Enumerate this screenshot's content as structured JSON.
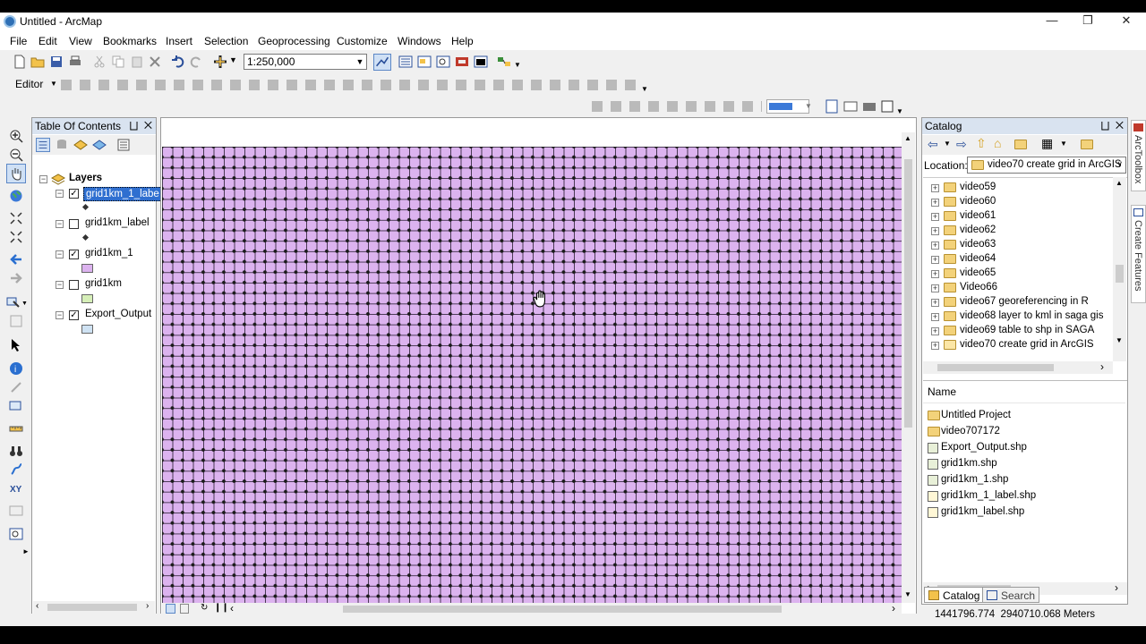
{
  "window": {
    "title": "Untitled - ArcMap",
    "minimize_icon": "minimize-icon",
    "maximize_icon": "maximize-icon",
    "close_icon": "close-icon"
  },
  "menu": [
    "File",
    "Edit",
    "View",
    "Bookmarks",
    "Insert",
    "Selection",
    "Geoprocessing",
    "Customize",
    "Windows",
    "Help"
  ],
  "toolbar": {
    "scale_value": "1:250,000",
    "editor_label": "Editor"
  },
  "toc": {
    "title": "Table Of Contents",
    "root": "Layers",
    "layers": [
      {
        "name": "grid1km_1_labe",
        "checked": true,
        "symbol": "point",
        "selected": true
      },
      {
        "name": "grid1km_label",
        "checked": false,
        "symbol": "point",
        "selected": false
      },
      {
        "name": "grid1km_1",
        "checked": true,
        "symbol": "#dcb3ef",
        "selected": false
      },
      {
        "name": "grid1km",
        "checked": false,
        "symbol": "#d6efb8",
        "selected": false
      },
      {
        "name": "Export_Output",
        "checked": true,
        "symbol": "#cfe2f3",
        "selected": false
      }
    ]
  },
  "catalog": {
    "title": "Catalog",
    "location_label": "Location:",
    "location_value": "video70 create grid in ArcGIS",
    "tree": [
      "video59",
      "video60",
      "video61",
      "video62",
      "video63",
      "video64",
      "video65",
      "Video66",
      "video67 georeferencing in R",
      "video68 layer to kml in saga gis",
      "video69 table to shp in SAGA",
      "video70 create grid in ArcGIS"
    ],
    "name_header": "Name",
    "contents": [
      {
        "name": "Untitled Project",
        "type": "folder"
      },
      {
        "name": "video707172",
        "type": "folder"
      },
      {
        "name": "Export_Output.shp",
        "type": "polygon"
      },
      {
        "name": "grid1km.shp",
        "type": "polygon"
      },
      {
        "name": "grid1km_1.shp",
        "type": "polygon"
      },
      {
        "name": "grid1km_1_label.shp",
        "type": "point"
      },
      {
        "name": "grid1km_label.shp",
        "type": "point"
      }
    ],
    "tab_catalog": "Catalog",
    "tab_search": "Search"
  },
  "side_tabs": {
    "arc_toolbox": "ArcToolbox",
    "create_features": "Create Features"
  },
  "status": {
    "coordinates": "1441796.774  2940710.068 Meters"
  },
  "map": {
    "fill_color": "#dcb3ef",
    "point_color": "#1a1a1a"
  }
}
